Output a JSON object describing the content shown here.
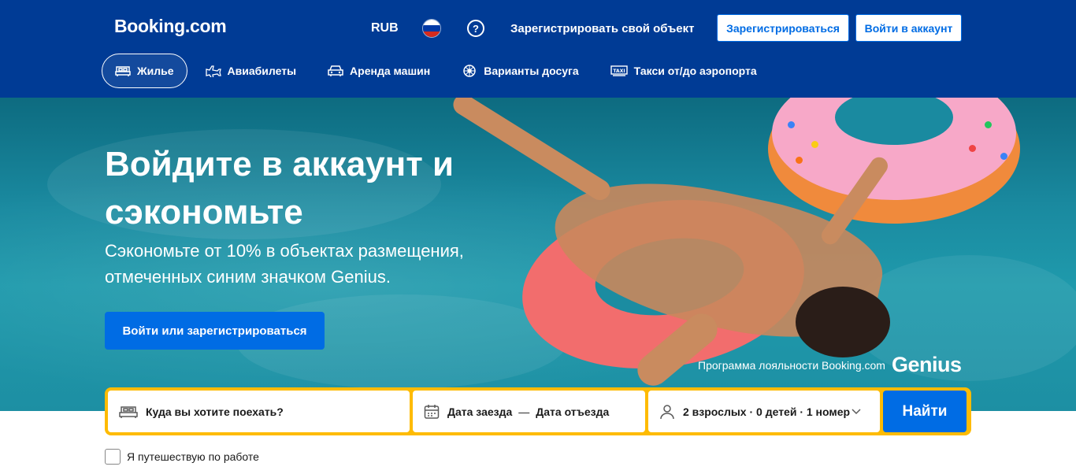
{
  "header": {
    "logo": "Booking.com",
    "currency": "RUB",
    "language_flag": "russia-flag",
    "help_icon": "question-circle-icon",
    "list_property": "Зарегистрировать свой объект",
    "register_label": "Зарегистрироваться",
    "signin_label": "Войти в аккаунт",
    "background_color": "#003b95"
  },
  "nav": {
    "tabs": [
      {
        "label": "Жилье",
        "icon": "bed-icon",
        "active": true
      },
      {
        "label": "Авиабилеты",
        "icon": "plane-icon",
        "active": false
      },
      {
        "label": "Аренда машин",
        "icon": "car-icon",
        "active": false
      },
      {
        "label": "Варианты досуга",
        "icon": "attractions-icon",
        "active": false
      },
      {
        "label": "Такси от/до аэропорта",
        "icon": "taxi-icon",
        "active": false
      }
    ]
  },
  "hero": {
    "title": "Войдите в аккаунт и сэкономьте",
    "subtitle": "Сэкономьте от 10% в объектах размещения, отмеченных синим значком Genius.",
    "cta_label": "Войти или зарегистрироваться",
    "genius_caption": "Программа лояльности Booking.com",
    "genius_logo": "Genius"
  },
  "search": {
    "destination_placeholder": "Куда вы хотите поехать?",
    "checkin": "Дата заезда",
    "dash": "—",
    "checkout": "Дата отъезда",
    "guests": "2 взрослых · 0 детей · 1 номер",
    "submit_label": "Найти",
    "accent_color": "#febb02",
    "button_color": "#006ce4"
  },
  "business_travel": {
    "label": "Я путешествую по работе",
    "checked": false
  }
}
